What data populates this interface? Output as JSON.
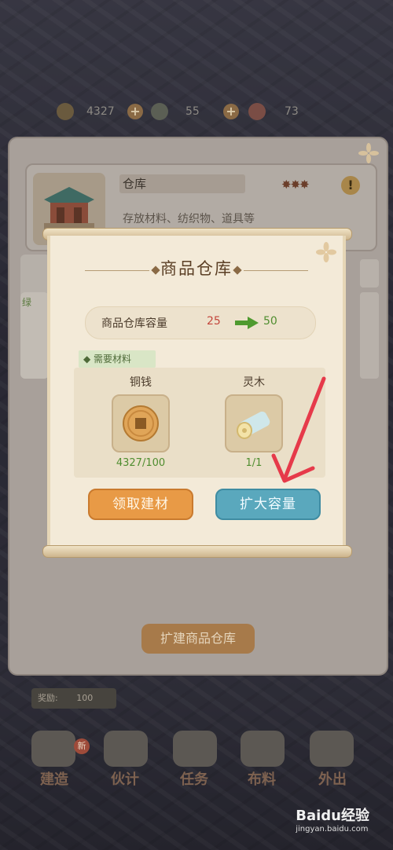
{
  "resources": [
    {
      "icon": "coin-icon",
      "value": "4327"
    },
    {
      "icon": "cloud-icon",
      "value": "55"
    },
    {
      "icon": "flower-icon",
      "value": "73"
    }
  ],
  "building": {
    "name": "仓库",
    "description": "存放材料、纺织物、道具等",
    "stars": "✸✸✸",
    "warning": "!",
    "side_label": "绿"
  },
  "dialog": {
    "title": "商品仓库",
    "capacity": {
      "label": "商品仓库容量",
      "current": "25",
      "next": "50"
    },
    "materials_label": "需要材料",
    "materials": [
      {
        "name": "铜钱",
        "icon": "copper-coin-icon",
        "count": "4327/100"
      },
      {
        "name": "灵木",
        "icon": "spirit-wood-icon",
        "count": "1/1"
      }
    ],
    "btn_collect": "领取建材",
    "btn_expand": "扩大容量"
  },
  "panel": {
    "expand_button": "扩建商品仓库"
  },
  "reward": {
    "label": "奖励:",
    "value": "100"
  },
  "nav": [
    {
      "label": "建造",
      "badge": "新"
    },
    {
      "label": "伙计"
    },
    {
      "label": "任务"
    },
    {
      "label": "布料"
    },
    {
      "label": "外出"
    }
  ],
  "watermark": {
    "brand": "Baidu经验",
    "url": "jingyan.baidu.com"
  }
}
